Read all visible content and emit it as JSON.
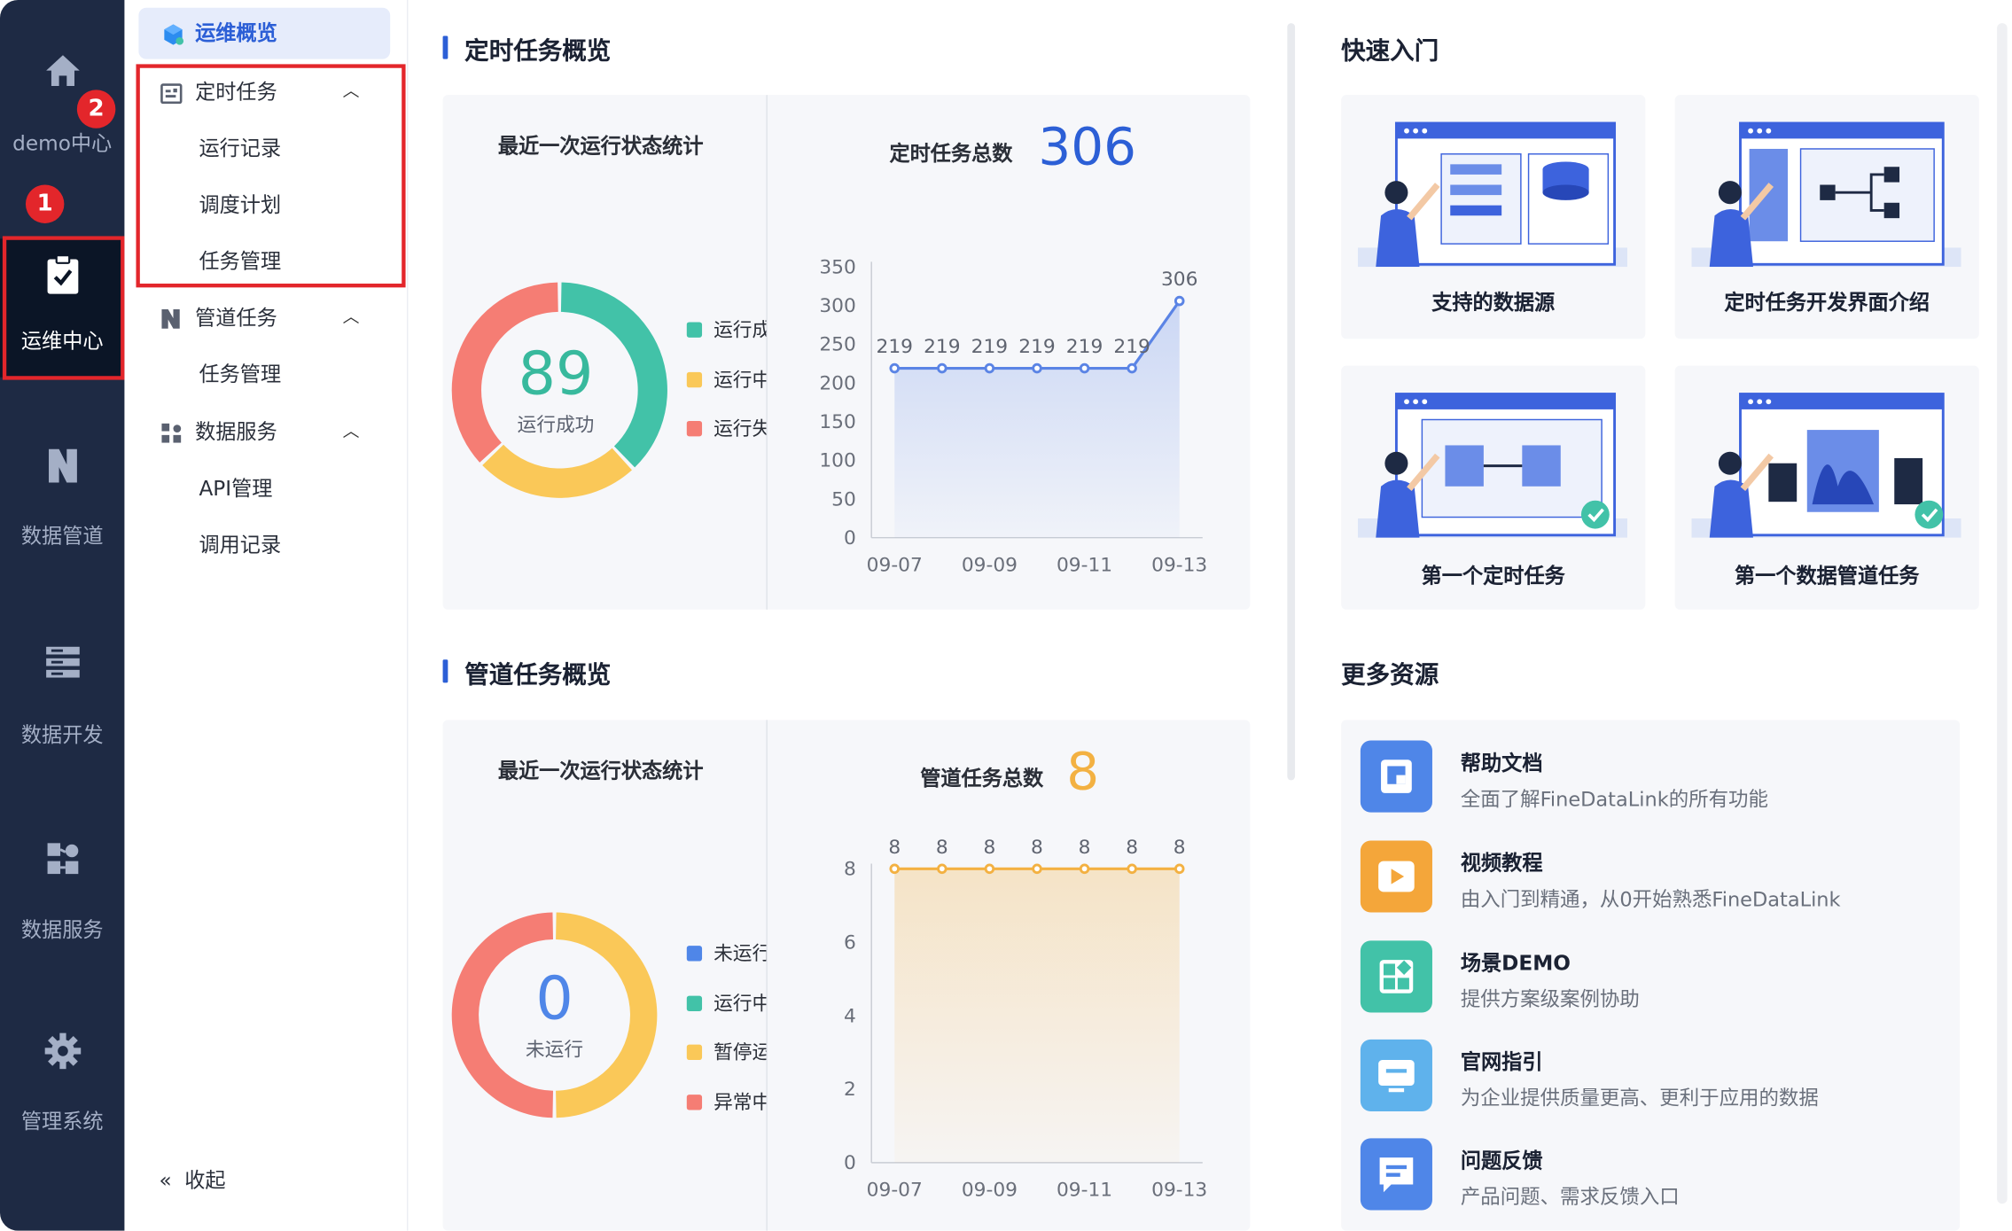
{
  "rail": {
    "items": [
      {
        "label": "demo中心",
        "icon": "home-icon"
      },
      {
        "label": "运维中心",
        "icon": "clipboard-check-icon"
      },
      {
        "label": "数据管道",
        "icon": "pipeline-icon"
      },
      {
        "label": "数据开发",
        "icon": "database-dev-icon"
      },
      {
        "label": "数据服务",
        "icon": "data-service-icon"
      },
      {
        "label": "管理系统",
        "icon": "gear-icon"
      }
    ],
    "badges": [
      "1",
      "2"
    ]
  },
  "subnav": {
    "top": "运维概览",
    "groups": [
      {
        "label": "定时任务",
        "children": [
          "运行记录",
          "调度计划",
          "任务管理"
        ]
      },
      {
        "label": "管道任务",
        "children": [
          "任务管理"
        ]
      },
      {
        "label": "数据服务",
        "children": [
          "API管理",
          "调用记录"
        ]
      }
    ],
    "collapse": "收起"
  },
  "timed": {
    "title": "定时任务概览",
    "stat_label": "最近一次运行状态统计",
    "donut_value": "89",
    "donut_caption": "运行成功",
    "legend": [
      "运行成功",
      "运行中",
      "运行失败"
    ],
    "total_label": "定时任务总数",
    "total_value": "306"
  },
  "pipe": {
    "title": "管道任务概览",
    "stat_label": "最近一次运行状态统计",
    "donut_value": "0",
    "donut_caption": "未运行",
    "legend": [
      "未运行",
      "运行中",
      "暂停运行",
      "异常中断"
    ],
    "total_label": "管道任务总数",
    "total_value": "8"
  },
  "quick": {
    "title": "快速入门",
    "cards": [
      "支持的数据源",
      "定时任务开发界面介绍",
      "第一个定时任务",
      "第一个数据管道任务"
    ]
  },
  "more": {
    "title": "更多资源",
    "items": [
      {
        "title": "帮助文档",
        "desc": "全面了解FineDataLink的所有功能",
        "icon": "book-icon",
        "color": "#4f86e8"
      },
      {
        "title": "视频教程",
        "desc": "由入门到精通，从0开始熟悉FineDataLink",
        "icon": "video-icon",
        "color": "#f4a63a"
      },
      {
        "title": "场景DEMO",
        "desc": "提供方案级案例协助",
        "icon": "grid-icon",
        "color": "#42c2a8"
      },
      {
        "title": "官网指引",
        "desc": "为企业提供质量更高、更利于应用的数据",
        "icon": "monitor-icon",
        "color": "#5fb2ec"
      },
      {
        "title": "问题反馈",
        "desc": "产品问题、需求反馈入口",
        "icon": "feedback-icon",
        "color": "#4f86e8"
      }
    ]
  },
  "chart_data": [
    {
      "type": "pie",
      "title": "最近一次运行状态统计",
      "center_value": "89",
      "center_label": "运行成功",
      "labels": [
        "运行成功",
        "运行中",
        "运行失败"
      ],
      "values": [
        0.38,
        0.25,
        0.37
      ],
      "colors": [
        "#42c2a8",
        "#fac858",
        "#f57d74"
      ]
    },
    {
      "type": "area",
      "title": "定时任务总数",
      "x": [
        "09-07",
        "09-08",
        "09-09",
        "09-10",
        "09-11",
        "09-12",
        "09-13"
      ],
      "x_ticks": [
        "09-07",
        "09-09",
        "09-11",
        "09-13"
      ],
      "values": [
        219,
        219,
        219,
        219,
        219,
        219,
        306
      ],
      "ylim": [
        0,
        350
      ],
      "yticks": [
        0,
        50,
        100,
        150,
        200,
        250,
        300,
        350
      ],
      "color": "#5b84e5"
    },
    {
      "type": "pie",
      "title": "最近一次运行状态统计",
      "center_value": "0",
      "center_label": "未运行",
      "labels": [
        "未运行",
        "运行中",
        "暂停运行",
        "异常中断"
      ],
      "values": [
        0,
        0,
        0.5,
        0.5
      ],
      "colors": [
        "#4f86e8",
        "#42c2a8",
        "#fac858",
        "#f57d74"
      ]
    },
    {
      "type": "area",
      "title": "管道任务总数",
      "x": [
        "09-07",
        "09-08",
        "09-09",
        "09-10",
        "09-11",
        "09-12",
        "09-13"
      ],
      "x_ticks": [
        "09-07",
        "09-09",
        "09-11",
        "09-13"
      ],
      "values": [
        8,
        8,
        8,
        8,
        8,
        8,
        8
      ],
      "ylim": [
        0,
        8
      ],
      "yticks": [
        0,
        2,
        4,
        6,
        8
      ],
      "color": "#f3b142"
    }
  ]
}
